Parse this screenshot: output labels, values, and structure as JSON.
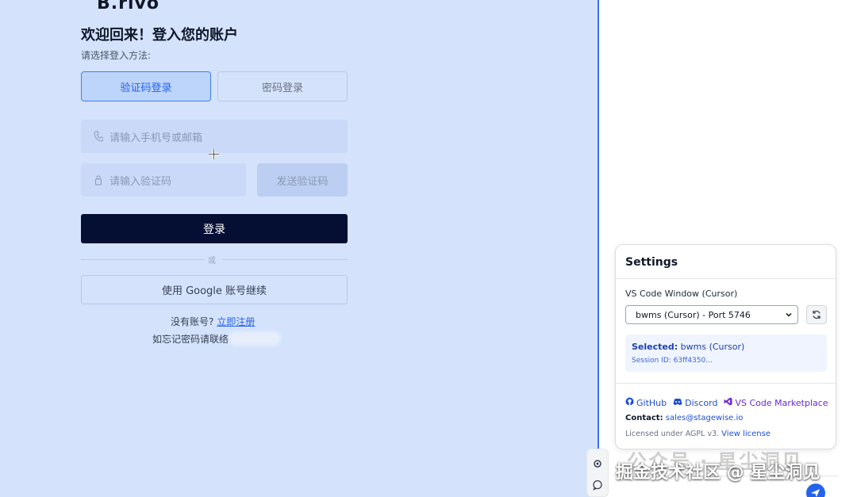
{
  "login": {
    "logo": "B.rivo",
    "title": "欢迎回来！登入您的账户",
    "subtitle": "请选择登入方法:",
    "tabs": [
      {
        "label": "验证码登录",
        "active": true
      },
      {
        "label": "密码登录",
        "active": false
      }
    ],
    "phone_placeholder": "请输入手机号或邮箱",
    "code_placeholder": "请输入验证码",
    "send_code": "发送验证码",
    "login_button": "登录",
    "or": "或",
    "google_button": "使用 Google 账号继续",
    "no_account": "没有账号?",
    "signup_link": "立即注册",
    "forgot": "如忘记密码请联络"
  },
  "settings": {
    "title": "Settings",
    "vs_label": "VS Code Window (Cursor)",
    "select_value": "bwms (Cursor) - Port 5746",
    "selected_label": "Selected:",
    "selected_value": "bwms (Cursor)",
    "session": "Session ID: 63ff4350...",
    "links": [
      "GitHub",
      "Discord",
      "VS Code Marketplace"
    ],
    "contact_label": "Contact:",
    "contact_email": "sales@stagewise.io",
    "license_text": "Licensed under AGPL v3.",
    "license_link": "View license"
  },
  "watermark": {
    "background": "公众号 · 星尘洞见",
    "foreground": "掘金技术社区 @ 星尘洞见"
  },
  "colors": {
    "login_bg": "#d4e2fc",
    "primary_button": "#050f33",
    "accent": "#2563eb"
  },
  "icons": {
    "phone": "phone-icon",
    "lock": "lock-icon",
    "refresh": "refresh-icon",
    "github": "github-icon",
    "discord": "discord-icon",
    "vscode": "vscode-icon",
    "send": "send-icon"
  }
}
